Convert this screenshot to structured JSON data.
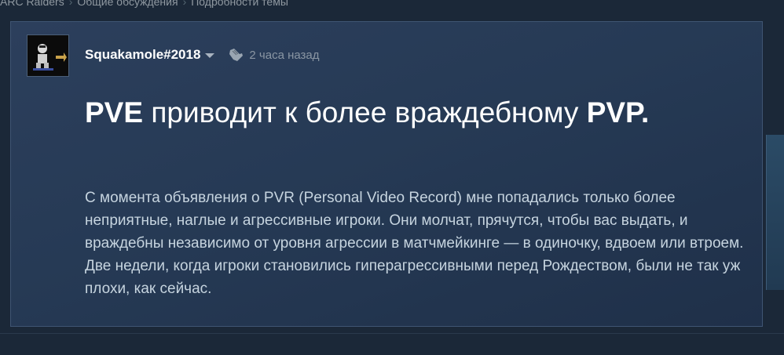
{
  "breadcrumb": {
    "items": [
      "ARC Raiders",
      "Общие обсуждения",
      "Подробности темы"
    ]
  },
  "post": {
    "author": "Squakamole#2018",
    "time": "2 часа назад",
    "title_bold": "PVE",
    "title_rest": " приводит к более враждебному ",
    "title_bold_end": "PVP.",
    "body": "С момента объявления о PVR (Personal Video Record) мне попадались только более неприятные, наглые и агрессивные игроки. Они молчат, прячутся, чтобы вас выдать, и враждебны независимо от уровня агрессии в матчмейкинге — в одиночку, вдвоем или втроем. Две недели, когда игроки становились гипер­агрессивными перед Рождеством, были не так уж плохи, как сейчас."
  },
  "colors": {
    "page_bg": "#1b2838",
    "card_bg": "#2c3f5c",
    "title_text": "#ffffff",
    "body_text": "#c6d4df",
    "muted_text": "#8a96a3"
  },
  "icons": {
    "author_menu": "chevron-down-icon",
    "time": "hand-pointer-icon"
  }
}
